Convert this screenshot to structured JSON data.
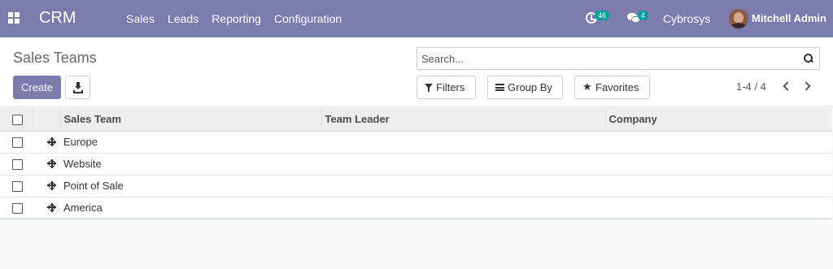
{
  "navbar": {
    "app_name": "CRM",
    "menu": [
      "Sales",
      "Leads",
      "Reporting",
      "Configuration"
    ],
    "activity_count": "46",
    "message_count": "4",
    "company": "Cybrosys",
    "user": "Mitchell Admin",
    "colors": {
      "bar": "#7c7bad",
      "badge": "#00a09d"
    },
    "icons": [
      "apps-grid-icon",
      "activity-clock-icon",
      "chat-bubbles-icon",
      "user-avatar"
    ]
  },
  "control_panel": {
    "title": "Sales Teams",
    "create_label": "Create",
    "download_icon": "download-icon",
    "search": {
      "placeholder": "Search...",
      "icon": "search-icon"
    },
    "filters_label": "Filters",
    "group_by_label": "Group By",
    "favorites_label": "Favorites",
    "pager": "1-4 / 4"
  },
  "table": {
    "columns": [
      "Sales Team",
      "Team Leader",
      "Company"
    ],
    "rows": [
      {
        "team": "Europe",
        "leader": "",
        "company": ""
      },
      {
        "team": "Website",
        "leader": "",
        "company": ""
      },
      {
        "team": "Point of Sale",
        "leader": "",
        "company": ""
      },
      {
        "team": "America",
        "leader": "",
        "company": ""
      }
    ]
  }
}
